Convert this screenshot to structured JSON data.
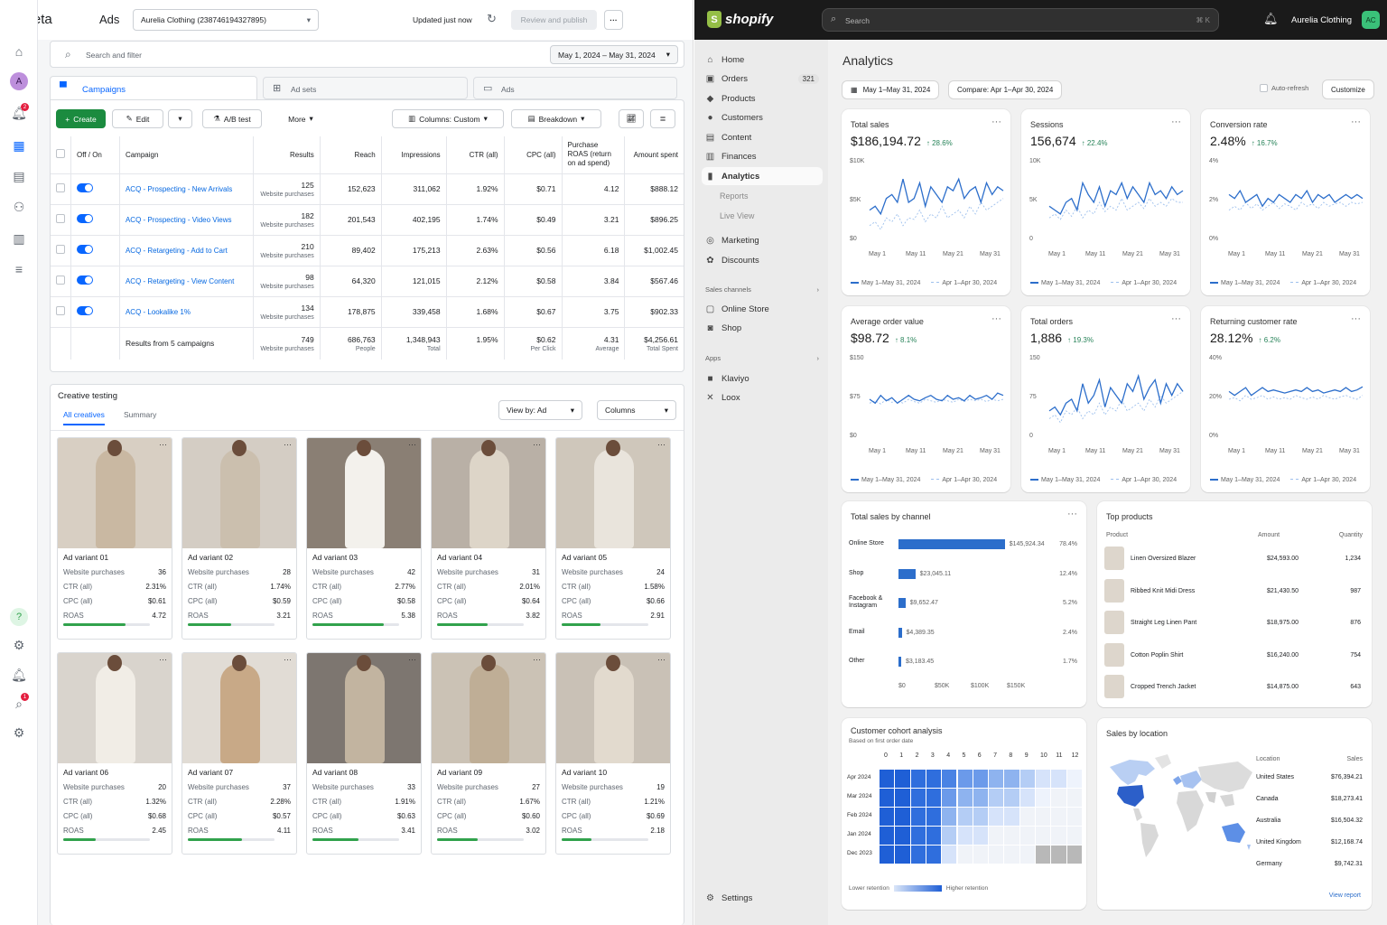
{
  "meta": {
    "logo": "Meta",
    "app": "Ads",
    "account": "Aurelia Clothing (238746194327895)",
    "updated": "Updated just now",
    "review_btn": "Review and publish",
    "search_placeholder": "Search and filter",
    "date_range": "May 1, 2024 – May 31, 2024",
    "level_tabs": [
      "Campaigns",
      "Ad sets",
      "Ads"
    ],
    "toolbar": {
      "create": "Create",
      "edit": "Edit",
      "ab": "A/B test",
      "more": "More",
      "columns": "Columns: Custom",
      "breakdown": "Breakdown"
    },
    "notif_count": "2",
    "search_count": "1",
    "avatar": "A",
    "columns": [
      "Off / On",
      "Campaign",
      "Results",
      "Reach",
      "Impressions",
      "CTR (all)",
      "CPC (all)",
      "Purchase ROAS (return on ad spend)",
      "Amount spent"
    ],
    "campaigns": [
      {
        "name": "ACQ - Prospecting - New Arrivals",
        "results": "125",
        "results_sub": "Website purchases",
        "reach": "152,623",
        "impr": "311,062",
        "ctr": "1.92%",
        "cpc": "$0.71",
        "roas": "4.12",
        "spent": "$888.12"
      },
      {
        "name": "ACQ - Prospecting - Video Views",
        "results": "182",
        "results_sub": "Website purchases",
        "reach": "201,543",
        "impr": "402,195",
        "ctr": "1.74%",
        "cpc": "$0.49",
        "roas": "3.21",
        "spent": "$896.25"
      },
      {
        "name": "ACQ - Retargeting - Add to Cart",
        "results": "210",
        "results_sub": "Website purchases",
        "reach": "89,402",
        "impr": "175,213",
        "ctr": "2.63%",
        "cpc": "$0.56",
        "roas": "6.18",
        "spent": "$1,002.45"
      },
      {
        "name": "ACQ - Retargeting - View Content",
        "results": "98",
        "results_sub": "Website purchases",
        "reach": "64,320",
        "impr": "121,015",
        "ctr": "2.12%",
        "cpc": "$0.58",
        "roas": "3.84",
        "spent": "$567.46"
      },
      {
        "name": "ACQ - Lookalike 1%",
        "results": "134",
        "results_sub": "Website purchases",
        "reach": "178,875",
        "impr": "339,458",
        "ctr": "1.68%",
        "cpc": "$0.67",
        "roas": "3.75",
        "spent": "$902.33"
      }
    ],
    "totals": {
      "label": "Results from 5 campaigns",
      "results": "749",
      "results_sub": "Website purchases",
      "reach": "686,763",
      "reach_sub": "People",
      "impr": "1,348,943",
      "impr_sub": "Total",
      "ctr": "1.95%",
      "cpc": "$0.62",
      "cpc_sub": "Per Click",
      "roas": "4.31",
      "roas_sub": "Average",
      "spent": "$4,256.61",
      "spent_sub": "Total Spent"
    },
    "creative": {
      "title": "Creative testing",
      "tabs": [
        "All creatives",
        "Summary"
      ],
      "view_by": "View by: Ad",
      "columns": "Columns",
      "metric_labels": [
        "Website purchases",
        "CTR (all)",
        "CPC (all)",
        "ROAS"
      ],
      "items": [
        {
          "name": "Ad variant 01",
          "purch": "36",
          "ctr": "2.31%",
          "cpc": "$0.61",
          "roas": "4.72",
          "bar": 0.72,
          "bg": "#d8cfc3",
          "coat": "#c9b8a2"
        },
        {
          "name": "Ad variant 02",
          "purch": "28",
          "ctr": "1.74%",
          "cpc": "$0.59",
          "roas": "3.21",
          "bar": 0.5,
          "bg": "#d4cdc4",
          "coat": "#cbbfae"
        },
        {
          "name": "Ad variant 03",
          "purch": "42",
          "ctr": "2.77%",
          "cpc": "$0.58",
          "roas": "5.38",
          "bar": 0.82,
          "bg": "#8a7f74",
          "coat": "#f3f1ec"
        },
        {
          "name": "Ad variant 04",
          "purch": "31",
          "ctr": "2.01%",
          "cpc": "$0.64",
          "roas": "3.82",
          "bar": 0.58,
          "bg": "#b9b0a6",
          "coat": "#ddd5c8"
        },
        {
          "name": "Ad variant 05",
          "purch": "24",
          "ctr": "1.58%",
          "cpc": "$0.66",
          "roas": "2.91",
          "bar": 0.45,
          "bg": "#cfc7bb",
          "coat": "#e9e4dc"
        },
        {
          "name": "Ad variant 06",
          "purch": "20",
          "ctr": "1.32%",
          "cpc": "$0.68",
          "roas": "2.45",
          "bar": 0.38,
          "bg": "#d9d4cd",
          "coat": "#f1ede6"
        },
        {
          "name": "Ad variant 07",
          "purch": "37",
          "ctr": "2.28%",
          "cpc": "$0.57",
          "roas": "4.11",
          "bar": 0.63,
          "bg": "#e1dcd5",
          "coat": "#c8a987"
        },
        {
          "name": "Ad variant 08",
          "purch": "33",
          "ctr": "1.91%",
          "cpc": "$0.63",
          "roas": "3.41",
          "bar": 0.53,
          "bg": "#7d7670",
          "coat": "#c2b4a0"
        },
        {
          "name": "Ad variant 09",
          "purch": "27",
          "ctr": "1.67%",
          "cpc": "$0.60",
          "roas": "3.02",
          "bar": 0.47,
          "bg": "#cbc2b5",
          "coat": "#bfae96"
        },
        {
          "name": "Ad variant 10",
          "purch": "19",
          "ctr": "1.21%",
          "cpc": "$0.69",
          "roas": "2.18",
          "bar": 0.34,
          "bg": "#c9c1b6",
          "coat": "#e2dace"
        }
      ]
    }
  },
  "shop": {
    "logo": "shopify",
    "search_placeholder": "Search",
    "search_shortcut": "⌘ K",
    "store": "Aurelia Clothing",
    "store_initials": "AC",
    "nav": [
      {
        "label": "Home",
        "icon": "home-icon",
        "glyph": "⌂"
      },
      {
        "label": "Orders",
        "icon": "orders-icon",
        "glyph": "▣",
        "badge": "321"
      },
      {
        "label": "Products",
        "icon": "products-icon",
        "glyph": "◆"
      },
      {
        "label": "Customers",
        "icon": "customers-icon",
        "glyph": "●"
      },
      {
        "label": "Content",
        "icon": "content-icon",
        "glyph": "▤"
      },
      {
        "label": "Finances",
        "icon": "finances-icon",
        "glyph": "▥"
      },
      {
        "label": "Analytics",
        "icon": "analytics-icon",
        "glyph": "▮"
      }
    ],
    "nav_sub": [
      "Reports",
      "Live View"
    ],
    "nav2": [
      {
        "label": "Marketing",
        "glyph": "◎"
      },
      {
        "label": "Discounts",
        "glyph": "✿"
      }
    ],
    "sales_channels": "Sales channels",
    "channels": [
      {
        "label": "Online Store",
        "glyph": "▢"
      },
      {
        "label": "Shop",
        "glyph": "◙"
      }
    ],
    "apps": "Apps",
    "app_list": [
      {
        "label": "Klaviyo",
        "glyph": "■"
      },
      {
        "label": "Loox",
        "glyph": "✕"
      }
    ],
    "settings": "Settings",
    "page_title": "Analytics",
    "date": "May 1–May 31, 2024",
    "compare": "Compare: Apr 1–Apr 30, 2024",
    "auto_refresh": "Auto-refresh",
    "customize": "Customize",
    "legend_cur": "May 1–May 31, 2024",
    "legend_prev": "Apr 1–Apr 30, 2024",
    "x_ticks": [
      "May 1",
      "May 11",
      "May 21",
      "May 31"
    ],
    "metrics": [
      {
        "title": "Total sales",
        "value": "$186,194.72",
        "delta": "↑ 28.6%",
        "y": [
          "$10K",
          "$5K",
          "$0"
        ],
        "cur": [
          0.4,
          0.45,
          0.35,
          0.55,
          0.6,
          0.5,
          0.8,
          0.5,
          0.55,
          0.75,
          0.45,
          0.7,
          0.6,
          0.5,
          0.7,
          0.65,
          0.8,
          0.55,
          0.65,
          0.7,
          0.5,
          0.75,
          0.6,
          0.7,
          0.65
        ],
        "prev": [
          0.2,
          0.25,
          0.15,
          0.3,
          0.25,
          0.35,
          0.2,
          0.3,
          0.28,
          0.4,
          0.25,
          0.35,
          0.3,
          0.45,
          0.3,
          0.35,
          0.4,
          0.3,
          0.45,
          0.35,
          0.5,
          0.4,
          0.45,
          0.5,
          0.55
        ]
      },
      {
        "title": "Sessions",
        "value": "156,674",
        "delta": "↑ 22.4%",
        "y": [
          "10K",
          "5K",
          "0"
        ],
        "cur": [
          0.45,
          0.4,
          0.35,
          0.5,
          0.55,
          0.4,
          0.75,
          0.6,
          0.5,
          0.7,
          0.45,
          0.65,
          0.6,
          0.75,
          0.55,
          0.7,
          0.6,
          0.5,
          0.75,
          0.6,
          0.65,
          0.55,
          0.7,
          0.6,
          0.65
        ],
        "prev": [
          0.3,
          0.35,
          0.28,
          0.4,
          0.32,
          0.45,
          0.3,
          0.4,
          0.35,
          0.5,
          0.38,
          0.45,
          0.4,
          0.55,
          0.4,
          0.45,
          0.5,
          0.42,
          0.55,
          0.45,
          0.5,
          0.45,
          0.55,
          0.5,
          0.5
        ]
      },
      {
        "title": "Conversion rate",
        "value": "2.48%",
        "delta": "↑ 16.7%",
        "y": [
          "4%",
          "2%",
          "0%"
        ],
        "cur": [
          0.6,
          0.55,
          0.65,
          0.5,
          0.55,
          0.6,
          0.45,
          0.55,
          0.5,
          0.6,
          0.55,
          0.5,
          0.6,
          0.55,
          0.65,
          0.5,
          0.6,
          0.55,
          0.6,
          0.5,
          0.55,
          0.6,
          0.55,
          0.6,
          0.55
        ],
        "prev": [
          0.4,
          0.45,
          0.4,
          0.5,
          0.42,
          0.48,
          0.4,
          0.45,
          0.5,
          0.42,
          0.48,
          0.45,
          0.4,
          0.5,
          0.45,
          0.48,
          0.42,
          0.5,
          0.45,
          0.48,
          0.5,
          0.45,
          0.5,
          0.48,
          0.5
        ]
      },
      {
        "title": "Average order value",
        "value": "$98.72",
        "delta": "↑ 8.1%",
        "y": [
          "$150",
          "$75",
          "$0"
        ],
        "cur": [
          0.5,
          0.45,
          0.55,
          0.48,
          0.52,
          0.45,
          0.5,
          0.55,
          0.5,
          0.48,
          0.52,
          0.55,
          0.5,
          0.48,
          0.55,
          0.5,
          0.52,
          0.48,
          0.55,
          0.5,
          0.52,
          0.55,
          0.5,
          0.58,
          0.55
        ],
        "prev": [
          0.45,
          0.48,
          0.44,
          0.5,
          0.46,
          0.48,
          0.45,
          0.5,
          0.47,
          0.45,
          0.5,
          0.48,
          0.46,
          0.5,
          0.48,
          0.46,
          0.5,
          0.47,
          0.5,
          0.48,
          0.5,
          0.47,
          0.5,
          0.48,
          0.5
        ]
      },
      {
        "title": "Total orders",
        "value": "1,886",
        "delta": "↑ 19.3%",
        "y": [
          "150",
          "75",
          "0"
        ],
        "cur": [
          0.35,
          0.4,
          0.3,
          0.45,
          0.5,
          0.35,
          0.7,
          0.45,
          0.55,
          0.75,
          0.4,
          0.65,
          0.55,
          0.45,
          0.7,
          0.6,
          0.8,
          0.5,
          0.65,
          0.75,
          0.45,
          0.7,
          0.55,
          0.7,
          0.6
        ],
        "prev": [
          0.25,
          0.3,
          0.2,
          0.35,
          0.3,
          0.4,
          0.25,
          0.35,
          0.3,
          0.45,
          0.3,
          0.4,
          0.35,
          0.5,
          0.35,
          0.4,
          0.45,
          0.35,
          0.5,
          0.4,
          0.55,
          0.45,
          0.5,
          0.55,
          0.6
        ]
      },
      {
        "title": "Returning customer rate",
        "value": "28.12%",
        "delta": "↑ 6.2%",
        "y": [
          "40%",
          "20%",
          "0%"
        ],
        "cur": [
          0.6,
          0.55,
          0.6,
          0.65,
          0.55,
          0.6,
          0.65,
          0.6,
          0.62,
          0.6,
          0.58,
          0.6,
          0.62,
          0.6,
          0.65,
          0.6,
          0.62,
          0.58,
          0.6,
          0.62,
          0.6,
          0.65,
          0.6,
          0.62,
          0.66
        ],
        "prev": [
          0.5,
          0.52,
          0.48,
          0.55,
          0.5,
          0.52,
          0.55,
          0.5,
          0.53,
          0.5,
          0.52,
          0.5,
          0.55,
          0.52,
          0.5,
          0.53,
          0.5,
          0.55,
          0.52,
          0.5,
          0.53,
          0.55,
          0.52,
          0.5,
          0.55
        ]
      }
    ],
    "channel_sales": {
      "title": "Total sales by channel",
      "rows": [
        {
          "label": "Online Store",
          "value": 145924.34,
          "amount": "$145,924.34",
          "pct": "78.4%"
        },
        {
          "label": "Shop",
          "value": 23045.11,
          "amount": "$23,045.11",
          "pct": "12.4%"
        },
        {
          "label": "Facebook & Instagram",
          "value": 9652.47,
          "amount": "$9,652.47",
          "pct": "5.2%"
        },
        {
          "label": "Email",
          "value": 4389.35,
          "amount": "$4,389.35",
          "pct": "2.4%"
        },
        {
          "label": "Other",
          "value": 3183.45,
          "amount": "$3,183.45",
          "pct": "1.7%"
        }
      ],
      "axis": [
        "$0",
        "$50K",
        "$100K",
        "$150K"
      ]
    },
    "top_products": {
      "title": "Top products",
      "headers": [
        "Product",
        "Amount",
        "Quantity"
      ],
      "rows": [
        {
          "name": "Linen Oversized Blazer",
          "amount": "$24,593.00",
          "qty": "1,234"
        },
        {
          "name": "Ribbed Knit Midi Dress",
          "amount": "$21,430.50",
          "qty": "987"
        },
        {
          "name": "Straight Leg Linen Pant",
          "amount": "$18,975.00",
          "qty": "876"
        },
        {
          "name": "Cotton Poplin Shirt",
          "amount": "$16,240.00",
          "qty": "754"
        },
        {
          "name": "Cropped Trench Jacket",
          "amount": "$14,875.00",
          "qty": "643"
        }
      ]
    },
    "cohort": {
      "title": "Customer cohort analysis",
      "subtitle": "Based on first order date",
      "cols": [
        "0",
        "1",
        "2",
        "3",
        "4",
        "5",
        "6",
        "7",
        "8",
        "9",
        "10",
        "11",
        "12"
      ],
      "rows": [
        "Apr 2024",
        "Mar 2024",
        "Feb 2024",
        "Jan 2024",
        "Dec 2023"
      ],
      "legend_low": "Lower retention",
      "legend_high": "Higher retention"
    },
    "location": {
      "title": "Sales by location",
      "headers": [
        "Location",
        "Sales"
      ],
      "rows": [
        {
          "name": "United States",
          "sales": "$76,394.21"
        },
        {
          "name": "Canada",
          "sales": "$18,273.41"
        },
        {
          "name": "Australia",
          "sales": "$16,504.32"
        },
        {
          "name": "United Kingdom",
          "sales": "$12,168.74"
        },
        {
          "name": "Germany",
          "sales": "$9,742.31"
        }
      ],
      "view_report": "View report"
    }
  }
}
